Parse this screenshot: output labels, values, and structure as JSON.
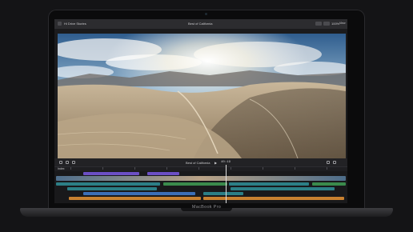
{
  "app": {
    "title": "Best of California",
    "library_label": "Hi Drive Stories",
    "zoom_label": "100%",
    "view_label": "View"
  },
  "viewer_bar": {
    "project_name": "Best of California",
    "timecode": "40:19",
    "index_label": "Index"
  },
  "device": {
    "brand": "MacBook Pro"
  },
  "colors": {
    "clip_purple": "#6b4fc4",
    "clip_teal": "#2c7f86",
    "clip_green": "#3a8a4c",
    "clip_blue": "#3c6fb6",
    "clip_orange": "#c88130"
  },
  "icons": [
    "camera-icon",
    "play-icon",
    "tool-icon",
    "snap-icon",
    "skimming-icon",
    "fullscreen-icon"
  ]
}
